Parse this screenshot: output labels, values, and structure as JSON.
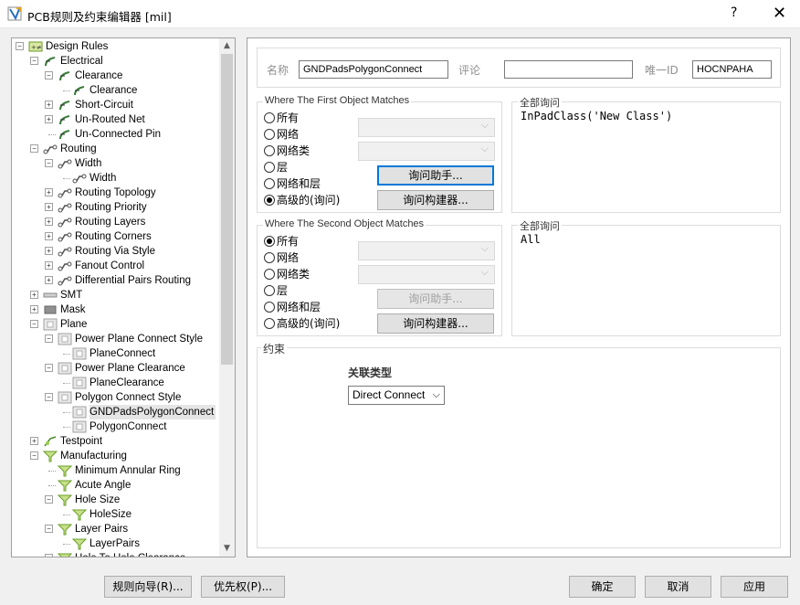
{
  "window": {
    "title": "PCB规则及约束编辑器 [mil]",
    "help": "?",
    "close": "✕"
  },
  "tree": [
    {
      "label": "Design Rules",
      "level": 0,
      "exp": "−",
      "icon": "rules"
    },
    {
      "label": "Electrical",
      "level": 1,
      "exp": "−",
      "icon": "electrical"
    },
    {
      "label": "Clearance",
      "level": 2,
      "exp": "−",
      "icon": "clearance"
    },
    {
      "label": "Clearance",
      "level": 3,
      "exp": "",
      "icon": "clearance"
    },
    {
      "label": "Short-Circuit",
      "level": 2,
      "exp": "+",
      "icon": "clearance"
    },
    {
      "label": "Un-Routed Net",
      "level": 2,
      "exp": "+",
      "icon": "clearance"
    },
    {
      "label": "Un-Connected Pin",
      "level": 2,
      "exp": "",
      "icon": "clearance"
    },
    {
      "label": "Routing",
      "level": 1,
      "exp": "−",
      "icon": "routing"
    },
    {
      "label": "Width",
      "level": 2,
      "exp": "−",
      "icon": "routing"
    },
    {
      "label": "Width",
      "level": 3,
      "exp": "",
      "icon": "routing"
    },
    {
      "label": "Routing Topology",
      "level": 2,
      "exp": "+",
      "icon": "routing"
    },
    {
      "label": "Routing Priority",
      "level": 2,
      "exp": "+",
      "icon": "routing"
    },
    {
      "label": "Routing Layers",
      "level": 2,
      "exp": "+",
      "icon": "routing"
    },
    {
      "label": "Routing Corners",
      "level": 2,
      "exp": "+",
      "icon": "routing"
    },
    {
      "label": "Routing Via Style",
      "level": 2,
      "exp": "+",
      "icon": "routing"
    },
    {
      "label": "Fanout Control",
      "level": 2,
      "exp": "+",
      "icon": "routing"
    },
    {
      "label": "Differential Pairs Routing",
      "level": 2,
      "exp": "+",
      "icon": "routing"
    },
    {
      "label": "SMT",
      "level": 1,
      "exp": "+",
      "icon": "smt"
    },
    {
      "label": "Mask",
      "level": 1,
      "exp": "+",
      "icon": "mask"
    },
    {
      "label": "Plane",
      "level": 1,
      "exp": "−",
      "icon": "plane"
    },
    {
      "label": "Power Plane Connect Style",
      "level": 2,
      "exp": "−",
      "icon": "plane"
    },
    {
      "label": "PlaneConnect",
      "level": 3,
      "exp": "",
      "icon": "plane"
    },
    {
      "label": "Power Plane Clearance",
      "level": 2,
      "exp": "−",
      "icon": "plane"
    },
    {
      "label": "PlaneClearance",
      "level": 3,
      "exp": "",
      "icon": "plane"
    },
    {
      "label": "Polygon Connect Style",
      "level": 2,
      "exp": "−",
      "icon": "plane"
    },
    {
      "label": "GNDPadsPolygonConnect",
      "level": 3,
      "exp": "",
      "icon": "plane",
      "selected": true
    },
    {
      "label": "PolygonConnect",
      "level": 3,
      "exp": "",
      "icon": "plane"
    },
    {
      "label": "Testpoint",
      "level": 1,
      "exp": "+",
      "icon": "testpoint"
    },
    {
      "label": "Manufacturing",
      "level": 1,
      "exp": "−",
      "icon": "manufacturing"
    },
    {
      "label": "Minimum Annular Ring",
      "level": 2,
      "exp": "",
      "icon": "manufacturing"
    },
    {
      "label": "Acute Angle",
      "level": 2,
      "exp": "",
      "icon": "manufacturing"
    },
    {
      "label": "Hole Size",
      "level": 2,
      "exp": "−",
      "icon": "manufacturing"
    },
    {
      "label": "HoleSize",
      "level": 3,
      "exp": "",
      "icon": "manufacturing"
    },
    {
      "label": "Layer Pairs",
      "level": 2,
      "exp": "−",
      "icon": "manufacturing"
    },
    {
      "label": "LayerPairs",
      "level": 3,
      "exp": "",
      "icon": "manufacturing"
    },
    {
      "label": "Hole To Hole Clearance",
      "level": 2,
      "exp": "−",
      "icon": "manufacturing"
    }
  ],
  "rule": {
    "name_label": "名称",
    "name_value": "GNDPadsPolygonConnect",
    "comment_label": "评论",
    "comment_value": "",
    "uid_label": "唯一ID",
    "uid_value": "HOCNPAHA"
  },
  "first": {
    "title": "Where The First Object Matches",
    "options": [
      "所有",
      "网络",
      "网络类",
      "层",
      "网络和层",
      "高级的(询问)"
    ],
    "selected": 5,
    "query_helper": "询问助手...",
    "query_builder": "询问构建器...",
    "full_query_title": "全部询问",
    "full_query": "InPadClass('New Class')"
  },
  "second": {
    "title": "Where The Second Object Matches",
    "options": [
      "所有",
      "网络",
      "网络类",
      "层",
      "网络和层",
      "高级的(询问)"
    ],
    "selected": 0,
    "query_helper": "询问助手...",
    "query_builder": "询问构建器...",
    "full_query_title": "全部询问",
    "full_query": "All"
  },
  "constraints": {
    "title": "约束",
    "connect_type_label": "关联类型",
    "connect_type_value": "Direct Connect"
  },
  "footer": {
    "rule_wizard": "规则向导(R)...",
    "priority": "优先权(P)...",
    "ok": "确定",
    "cancel": "取消",
    "apply": "应用"
  },
  "colors": {
    "accent": "#0078d7",
    "selection": "#e5e5e5"
  }
}
